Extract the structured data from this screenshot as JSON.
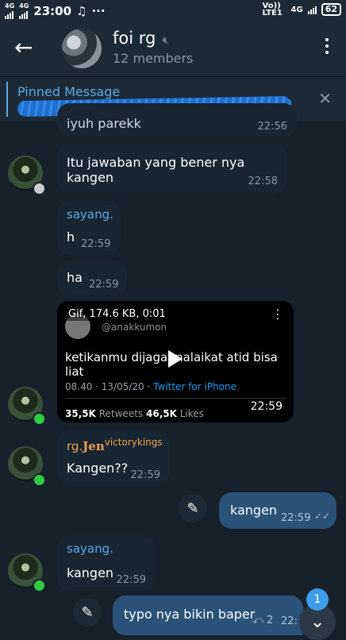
{
  "status_bar": {
    "network_left": "4G",
    "network_left2": "4G",
    "time": "23:00",
    "icons_left": [
      "music-note-icon",
      "more-dots-icon"
    ],
    "volte": "Vo)) LTE1",
    "network_right": "4G",
    "battery": "62"
  },
  "header": {
    "title": "foi rg",
    "members": "12 members"
  },
  "pinned": {
    "label": "Pinned Message"
  },
  "messages": {
    "m1": {
      "text": "iyuh parekk",
      "time": "22:56"
    },
    "m2": {
      "text": "Itu jawaban yang bener nya kangen",
      "time": "22:58"
    },
    "m3": {
      "sender": "sayang.",
      "text": "h",
      "time": "22:59"
    },
    "m4": {
      "text": "ha",
      "time": "22:59"
    },
    "gif": {
      "info": "Gif, 174.6 KB, 0:01",
      "handle": "@anakkumon",
      "tweet": "ketikanmu dijaga malaikat atid bisa liat",
      "meta_date": "08.40 · 13/05/20 ·",
      "meta_source": "Twitter for iPhone",
      "retweets": "35,5K",
      "retweets_label": "Retweets",
      "likes": "46,5K",
      "likes_label": "Likes",
      "time": "22:59"
    },
    "m5": {
      "sender_prefix": "rg.",
      "sender_name": "Jen",
      "sender_suffix": "victorykings",
      "text": "Kangen??",
      "time": "22:59"
    },
    "m6": {
      "text": "kangen",
      "time": "22:59"
    },
    "m7": {
      "sender": "sayang.",
      "text": "kangen",
      "time": "22:59"
    },
    "m8": {
      "text": "typo nya bikin baper",
      "replies": "2",
      "time": "22:"
    }
  },
  "scroll_badge": "1",
  "colors": {
    "background": "#17212b",
    "incoming": "#182533",
    "outgoing": "#2b5278",
    "accent": "#5fa8e0",
    "sender_orange": "#e8a24a",
    "online_green": "#2ecc40"
  }
}
